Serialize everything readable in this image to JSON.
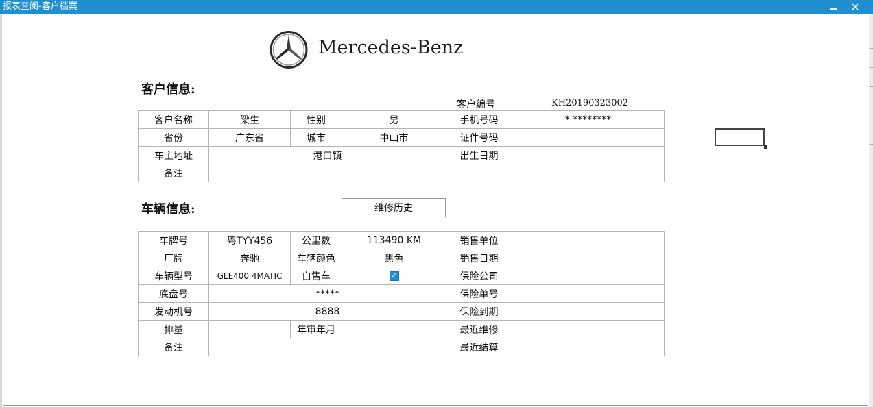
{
  "window": {
    "title": "报表查阅-客户档案",
    "minimize_icon": "minimize-icon",
    "close_icon": "close-icon",
    "close_glyph": "✕"
  },
  "logo": {
    "text": "Mercedes-Benz",
    "icon": "mercedes-star-icon"
  },
  "customer": {
    "section_title": "客户信息:",
    "id_label": "客户编号",
    "id_value": "KH20190323002",
    "rows": [
      [
        "客户名称",
        "梁生",
        "性别",
        "男",
        "手机号码",
        "* ********"
      ],
      [
        "省份",
        "广东省",
        "城市",
        "中山市",
        "证件号码",
        ""
      ],
      [
        "车主地址",
        "港口镇",
        "出生日期",
        ""
      ],
      [
        "备注",
        ""
      ]
    ]
  },
  "vehicle": {
    "section_title": "车辆信息:",
    "history_button": "维修历史",
    "self_sale_checked": true,
    "self_sale_glyph": "✓",
    "rows": [
      [
        "车牌号",
        "粤TYY456",
        "公里数",
        "113490 KM",
        "销售单位",
        ""
      ],
      [
        "厂牌",
        "奔驰",
        "车辆颜色",
        "黑色",
        "销售日期",
        ""
      ],
      [
        "车辆型号",
        "GLE400 4MATIC",
        "自售车",
        "",
        "保险公司",
        ""
      ],
      [
        "底盘号",
        "*****",
        "保险单号",
        ""
      ],
      [
        "发动机号",
        "8888",
        "保险到期",
        ""
      ],
      [
        "排量",
        "",
        "年审年月",
        "",
        "最近维修",
        ""
      ],
      [
        "备注",
        "",
        "最近结算",
        ""
      ]
    ]
  }
}
